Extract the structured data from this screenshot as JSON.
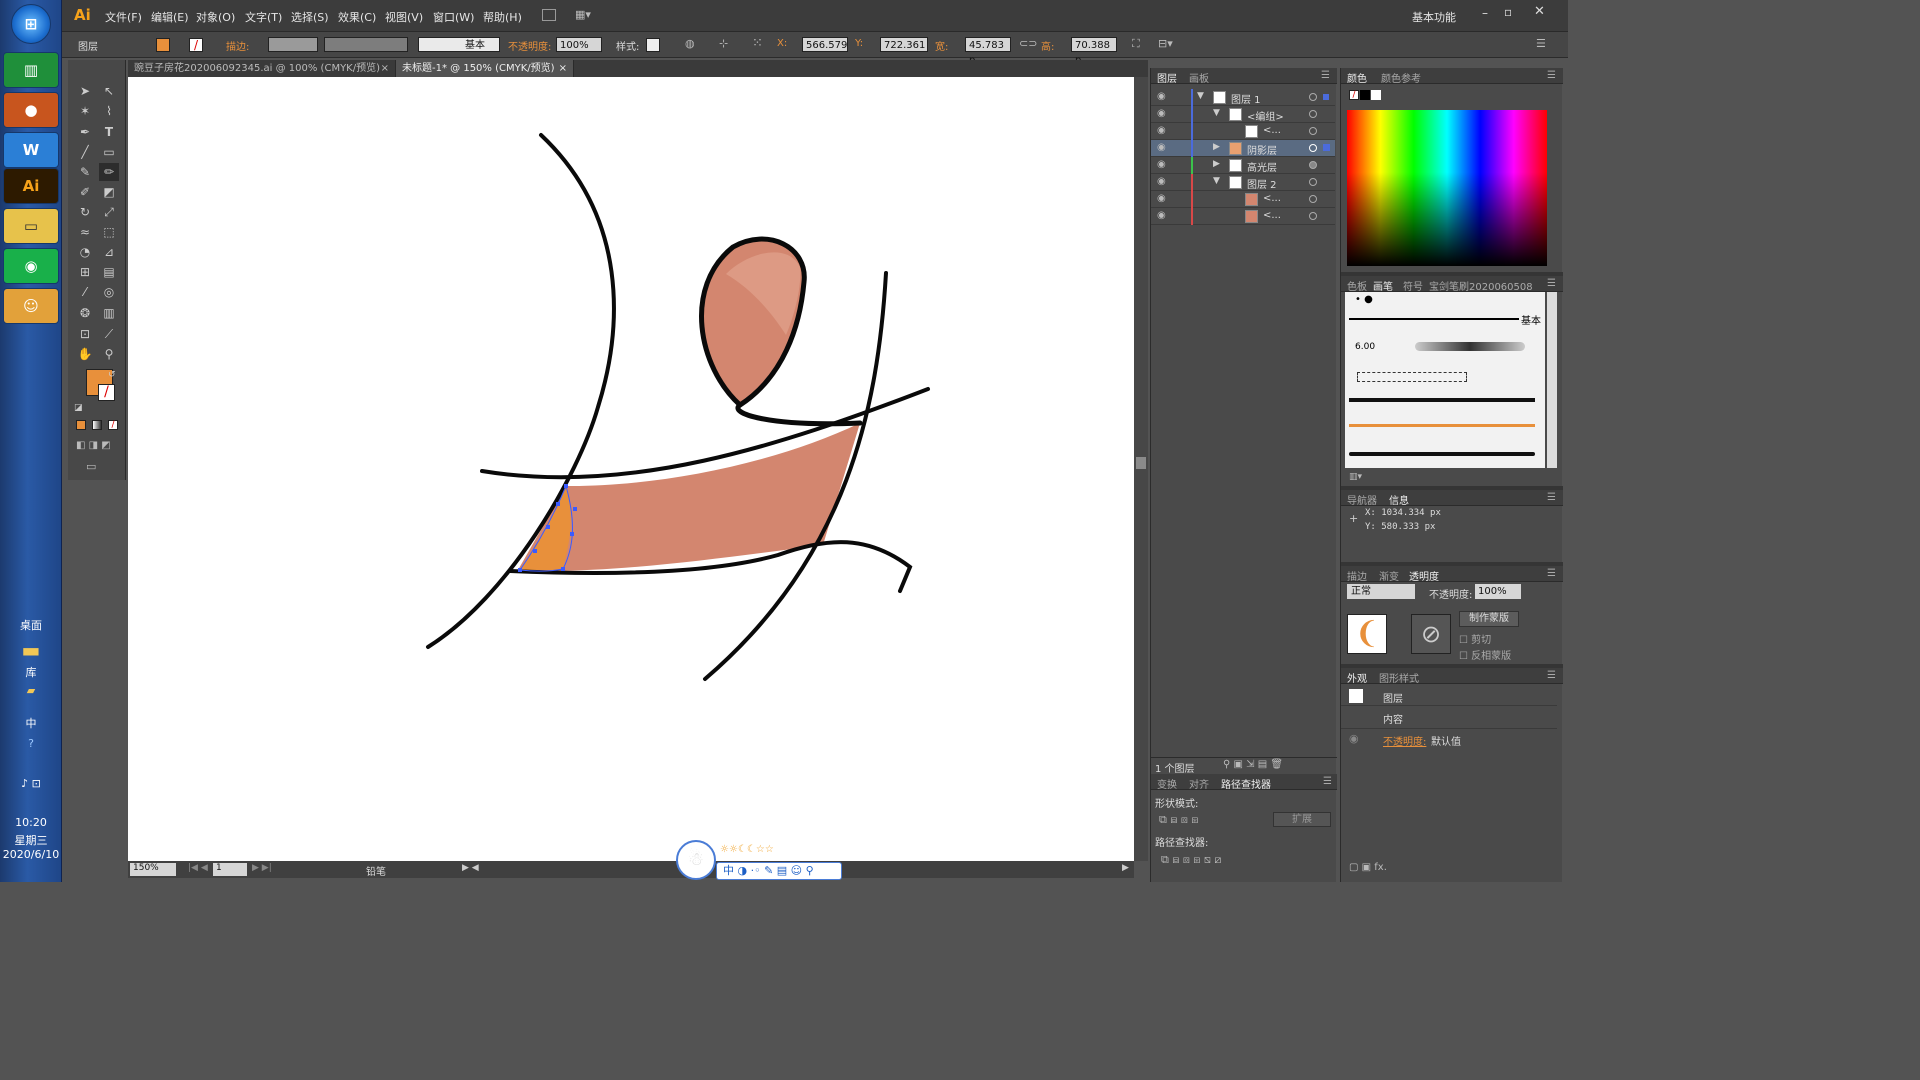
{
  "taskbar": {
    "desktop_label": "桌面",
    "library_label": "库",
    "ime_label": "中",
    "time": "10:20",
    "weekday": "星期三",
    "date": "2020/6/10"
  },
  "menubar": {
    "logo": "Ai",
    "items": [
      "文件(F)",
      "编辑(E)",
      "对象(O)",
      "文字(T)",
      "选择(S)",
      "效果(C)",
      "视图(V)",
      "窗口(W)",
      "帮助(H)"
    ],
    "workspace": "基本功能"
  },
  "control": {
    "selection_label": "图层",
    "stroke_label": "描边:",
    "stroke_style": "基本",
    "opacity_label": "不透明度:",
    "opacity_value": "100%",
    "style_label": "样式:",
    "x_label": "X:",
    "x_value": "566.579",
    "y_label": "Y:",
    "y_value": "722.361",
    "w_label": "宽:",
    "w_value": "45.783 p",
    "h_label": "高:",
    "h_value": "70.388 p",
    "fill_color": "#e8903b"
  },
  "tabs": [
    {
      "label": "豌豆子房花202006092345.ai @ 100% (CMYK/预览)"
    },
    {
      "label": "未标题-1* @ 150% (CMYK/预览)"
    }
  ],
  "status": {
    "zoom": "150%",
    "page": "1",
    "tool": "铅笔"
  },
  "layers_panel": {
    "tabs": [
      "图层",
      "画板"
    ],
    "rows": [
      {
        "name": "图层 1"
      },
      {
        "name": "<编组>"
      },
      {
        "name": "<..."
      },
      {
        "name": "阴影层"
      },
      {
        "name": "高光层"
      },
      {
        "name": "图层 2"
      },
      {
        "name": "<..."
      },
      {
        "name": "<..."
      }
    ],
    "footer_count": "1 个图层"
  },
  "pathfinder": {
    "tabs": [
      "变换",
      "对齐",
      "路径查找器"
    ],
    "shape_modes_label": "形状模式:",
    "expand_button": "扩展",
    "pathfinders_label": "路径查找器:"
  },
  "color_panel": {
    "tabs": [
      "颜色",
      "颜色参考"
    ]
  },
  "brush_panel": {
    "tabs": [
      "色板",
      "画笔",
      "符号",
      "宝剑笔刷2020060508"
    ],
    "basic_label": "基本",
    "size_label": "6.00"
  },
  "info_panel": {
    "tabs": [
      "导航器",
      "信息"
    ],
    "x_readout": "X: 1034.334 px",
    "y_readout": "Y: 580.333 px"
  },
  "transparency_panel": {
    "tabs": [
      "描边",
      "渐变",
      "透明度"
    ],
    "blend_mode": "正常",
    "opacity_label": "不透明度:",
    "opacity_value": "100%",
    "make_mask": "制作蒙版",
    "clip": "剪切",
    "invert_mask": "反相蒙版"
  },
  "appearance_panel": {
    "tabs": [
      "外观",
      "图形样式"
    ],
    "target": "图层",
    "content": "内容",
    "opacity_label": "不透明度:",
    "opacity_value": "默认值"
  },
  "artwork": {
    "skin_color": "#d3866f",
    "highlight_color": "#dd9a84",
    "selection_fill": "#e8903b",
    "stroke": "#0a0a0a"
  }
}
